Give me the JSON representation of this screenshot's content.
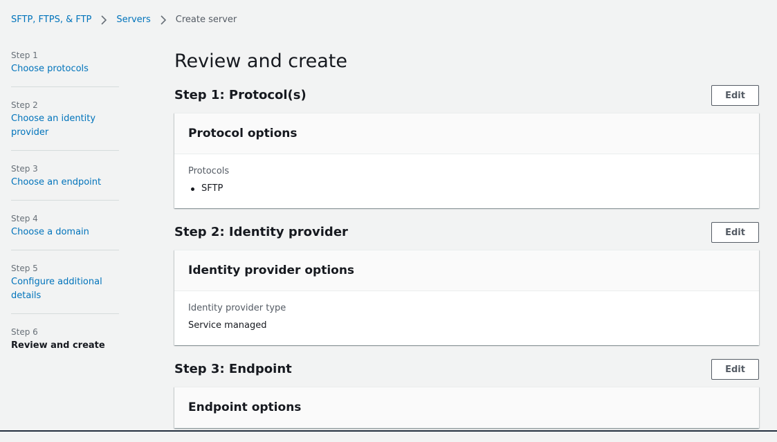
{
  "breadcrumb": {
    "items": [
      "SFTP, FTPS, & FTP",
      "Servers",
      "Create server"
    ]
  },
  "wizard": {
    "steps": [
      {
        "number": "Step 1",
        "label": "Choose protocols"
      },
      {
        "number": "Step 2",
        "label": "Choose an identity provider"
      },
      {
        "number": "Step 3",
        "label": "Choose an endpoint"
      },
      {
        "number": "Step 4",
        "label": "Choose a domain"
      },
      {
        "number": "Step 5",
        "label": "Configure additional details"
      },
      {
        "number": "Step 6",
        "label": "Review and create"
      }
    ],
    "current_step": 6
  },
  "main": {
    "title": "Review and create",
    "sections": [
      {
        "heading": "Step 1: Protocol(s)",
        "edit_label": "Edit",
        "panel_title": "Protocol options",
        "field_label": "Protocols",
        "list": [
          "SFTP"
        ]
      },
      {
        "heading": "Step 2: Identity provider",
        "edit_label": "Edit",
        "panel_title": "Identity provider options",
        "field_label": "Identity provider type",
        "value": "Service managed"
      },
      {
        "heading": "Step 3: Endpoint",
        "edit_label": "Edit",
        "panel_title": "Endpoint options"
      }
    ]
  },
  "colors": {
    "link": "#0073bb",
    "background": "#f2f3f3",
    "text": "#16191f",
    "muted": "#687078"
  },
  "icons": {
    "breadcrumb_separator": "chevron-right-icon"
  }
}
